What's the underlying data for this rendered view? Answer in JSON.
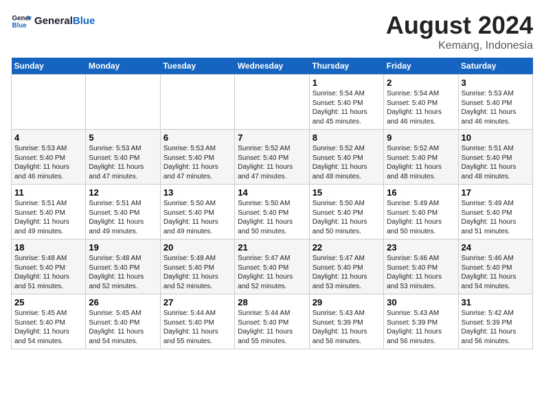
{
  "header": {
    "logo_general": "General",
    "logo_blue": "Blue",
    "month_year": "August 2024",
    "location": "Kemang, Indonesia"
  },
  "days_of_week": [
    "Sunday",
    "Monday",
    "Tuesday",
    "Wednesday",
    "Thursday",
    "Friday",
    "Saturday"
  ],
  "weeks": [
    [
      {
        "day": "",
        "info": ""
      },
      {
        "day": "",
        "info": ""
      },
      {
        "day": "",
        "info": ""
      },
      {
        "day": "",
        "info": ""
      },
      {
        "day": "1",
        "info": "Sunrise: 5:54 AM\nSunset: 5:40 PM\nDaylight: 11 hours\nand 45 minutes."
      },
      {
        "day": "2",
        "info": "Sunrise: 5:54 AM\nSunset: 5:40 PM\nDaylight: 11 hours\nand 46 minutes."
      },
      {
        "day": "3",
        "info": "Sunrise: 5:53 AM\nSunset: 5:40 PM\nDaylight: 11 hours\nand 46 minutes."
      }
    ],
    [
      {
        "day": "4",
        "info": "Sunrise: 5:53 AM\nSunset: 5:40 PM\nDaylight: 11 hours\nand 46 minutes."
      },
      {
        "day": "5",
        "info": "Sunrise: 5:53 AM\nSunset: 5:40 PM\nDaylight: 11 hours\nand 47 minutes."
      },
      {
        "day": "6",
        "info": "Sunrise: 5:53 AM\nSunset: 5:40 PM\nDaylight: 11 hours\nand 47 minutes."
      },
      {
        "day": "7",
        "info": "Sunrise: 5:52 AM\nSunset: 5:40 PM\nDaylight: 11 hours\nand 47 minutes."
      },
      {
        "day": "8",
        "info": "Sunrise: 5:52 AM\nSunset: 5:40 PM\nDaylight: 11 hours\nand 48 minutes."
      },
      {
        "day": "9",
        "info": "Sunrise: 5:52 AM\nSunset: 5:40 PM\nDaylight: 11 hours\nand 48 minutes."
      },
      {
        "day": "10",
        "info": "Sunrise: 5:51 AM\nSunset: 5:40 PM\nDaylight: 11 hours\nand 48 minutes."
      }
    ],
    [
      {
        "day": "11",
        "info": "Sunrise: 5:51 AM\nSunset: 5:40 PM\nDaylight: 11 hours\nand 49 minutes."
      },
      {
        "day": "12",
        "info": "Sunrise: 5:51 AM\nSunset: 5:40 PM\nDaylight: 11 hours\nand 49 minutes."
      },
      {
        "day": "13",
        "info": "Sunrise: 5:50 AM\nSunset: 5:40 PM\nDaylight: 11 hours\nand 49 minutes."
      },
      {
        "day": "14",
        "info": "Sunrise: 5:50 AM\nSunset: 5:40 PM\nDaylight: 11 hours\nand 50 minutes."
      },
      {
        "day": "15",
        "info": "Sunrise: 5:50 AM\nSunset: 5:40 PM\nDaylight: 11 hours\nand 50 minutes."
      },
      {
        "day": "16",
        "info": "Sunrise: 5:49 AM\nSunset: 5:40 PM\nDaylight: 11 hours\nand 50 minutes."
      },
      {
        "day": "17",
        "info": "Sunrise: 5:49 AM\nSunset: 5:40 PM\nDaylight: 11 hours\nand 51 minutes."
      }
    ],
    [
      {
        "day": "18",
        "info": "Sunrise: 5:48 AM\nSunset: 5:40 PM\nDaylight: 11 hours\nand 51 minutes."
      },
      {
        "day": "19",
        "info": "Sunrise: 5:48 AM\nSunset: 5:40 PM\nDaylight: 11 hours\nand 52 minutes."
      },
      {
        "day": "20",
        "info": "Sunrise: 5:48 AM\nSunset: 5:40 PM\nDaylight: 11 hours\nand 52 minutes."
      },
      {
        "day": "21",
        "info": "Sunrise: 5:47 AM\nSunset: 5:40 PM\nDaylight: 11 hours\nand 52 minutes."
      },
      {
        "day": "22",
        "info": "Sunrise: 5:47 AM\nSunset: 5:40 PM\nDaylight: 11 hours\nand 53 minutes."
      },
      {
        "day": "23",
        "info": "Sunrise: 5:46 AM\nSunset: 5:40 PM\nDaylight: 11 hours\nand 53 minutes."
      },
      {
        "day": "24",
        "info": "Sunrise: 5:46 AM\nSunset: 5:40 PM\nDaylight: 11 hours\nand 54 minutes."
      }
    ],
    [
      {
        "day": "25",
        "info": "Sunrise: 5:45 AM\nSunset: 5:40 PM\nDaylight: 11 hours\nand 54 minutes."
      },
      {
        "day": "26",
        "info": "Sunrise: 5:45 AM\nSunset: 5:40 PM\nDaylight: 11 hours\nand 54 minutes."
      },
      {
        "day": "27",
        "info": "Sunrise: 5:44 AM\nSunset: 5:40 PM\nDaylight: 11 hours\nand 55 minutes."
      },
      {
        "day": "28",
        "info": "Sunrise: 5:44 AM\nSunset: 5:40 PM\nDaylight: 11 hours\nand 55 minutes."
      },
      {
        "day": "29",
        "info": "Sunrise: 5:43 AM\nSunset: 5:39 PM\nDaylight: 11 hours\nand 56 minutes."
      },
      {
        "day": "30",
        "info": "Sunrise: 5:43 AM\nSunset: 5:39 PM\nDaylight: 11 hours\nand 56 minutes."
      },
      {
        "day": "31",
        "info": "Sunrise: 5:42 AM\nSunset: 5:39 PM\nDaylight: 11 hours\nand 56 minutes."
      }
    ]
  ]
}
